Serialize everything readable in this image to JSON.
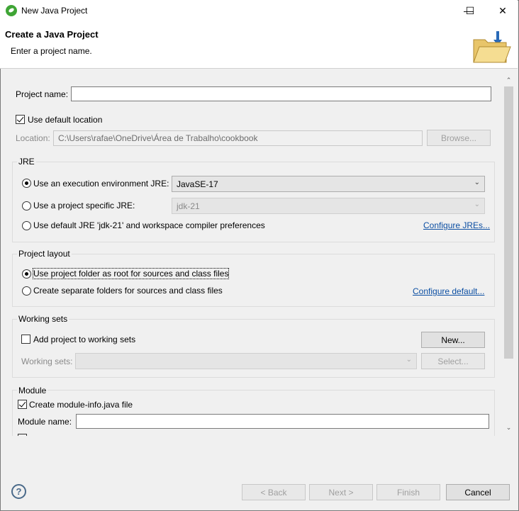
{
  "window": {
    "title": "New Java Project",
    "minimize": "—",
    "maximize": "☐",
    "close": "✕"
  },
  "header": {
    "title": "Create a Java Project",
    "subtitle": "Enter a project name."
  },
  "project_name": {
    "label": "Project name:",
    "value": ""
  },
  "use_default_location": {
    "label": "Use default location",
    "checked": true
  },
  "location": {
    "label": "Location:",
    "value": "C:\\Users\\rafae\\OneDrive\\Área de Trabalho\\cookbook",
    "browse": "Browse..."
  },
  "jre": {
    "title": "JRE",
    "exec_env_label": "Use an execution environment JRE:",
    "exec_env_value": "JavaSE-17",
    "project_specific_label": "Use a project specific JRE:",
    "project_specific_value": "jdk-21",
    "default_label": "Use default JRE 'jdk-21' and workspace compiler preferences",
    "configure_link": "Configure JREs...",
    "selected": "exec_env"
  },
  "project_layout": {
    "title": "Project layout",
    "option1": "Use project folder as root for sources and class files",
    "option2": "Create separate folders for sources and class files",
    "configure_link": "Configure default...",
    "selected": "option1"
  },
  "working_sets": {
    "title": "Working sets",
    "add_label": "Add project to working sets",
    "new_button": "New...",
    "sets_label": "Working sets:",
    "select_button": "Select..."
  },
  "module": {
    "title": "Module",
    "create_label": "Create module-info.java file",
    "name_label": "Module name:",
    "name_value": ""
  },
  "footer": {
    "help": "?",
    "back": "< Back",
    "next": "Next >",
    "finish": "Finish",
    "cancel": "Cancel"
  },
  "icons": {
    "app": "eclipse-icon",
    "banner": "folder-icon",
    "chevron": "chevron-down-icon",
    "help": "help-icon"
  },
  "colors": {
    "link": "#0b4ea2",
    "default_button_border": "#0078d7"
  }
}
